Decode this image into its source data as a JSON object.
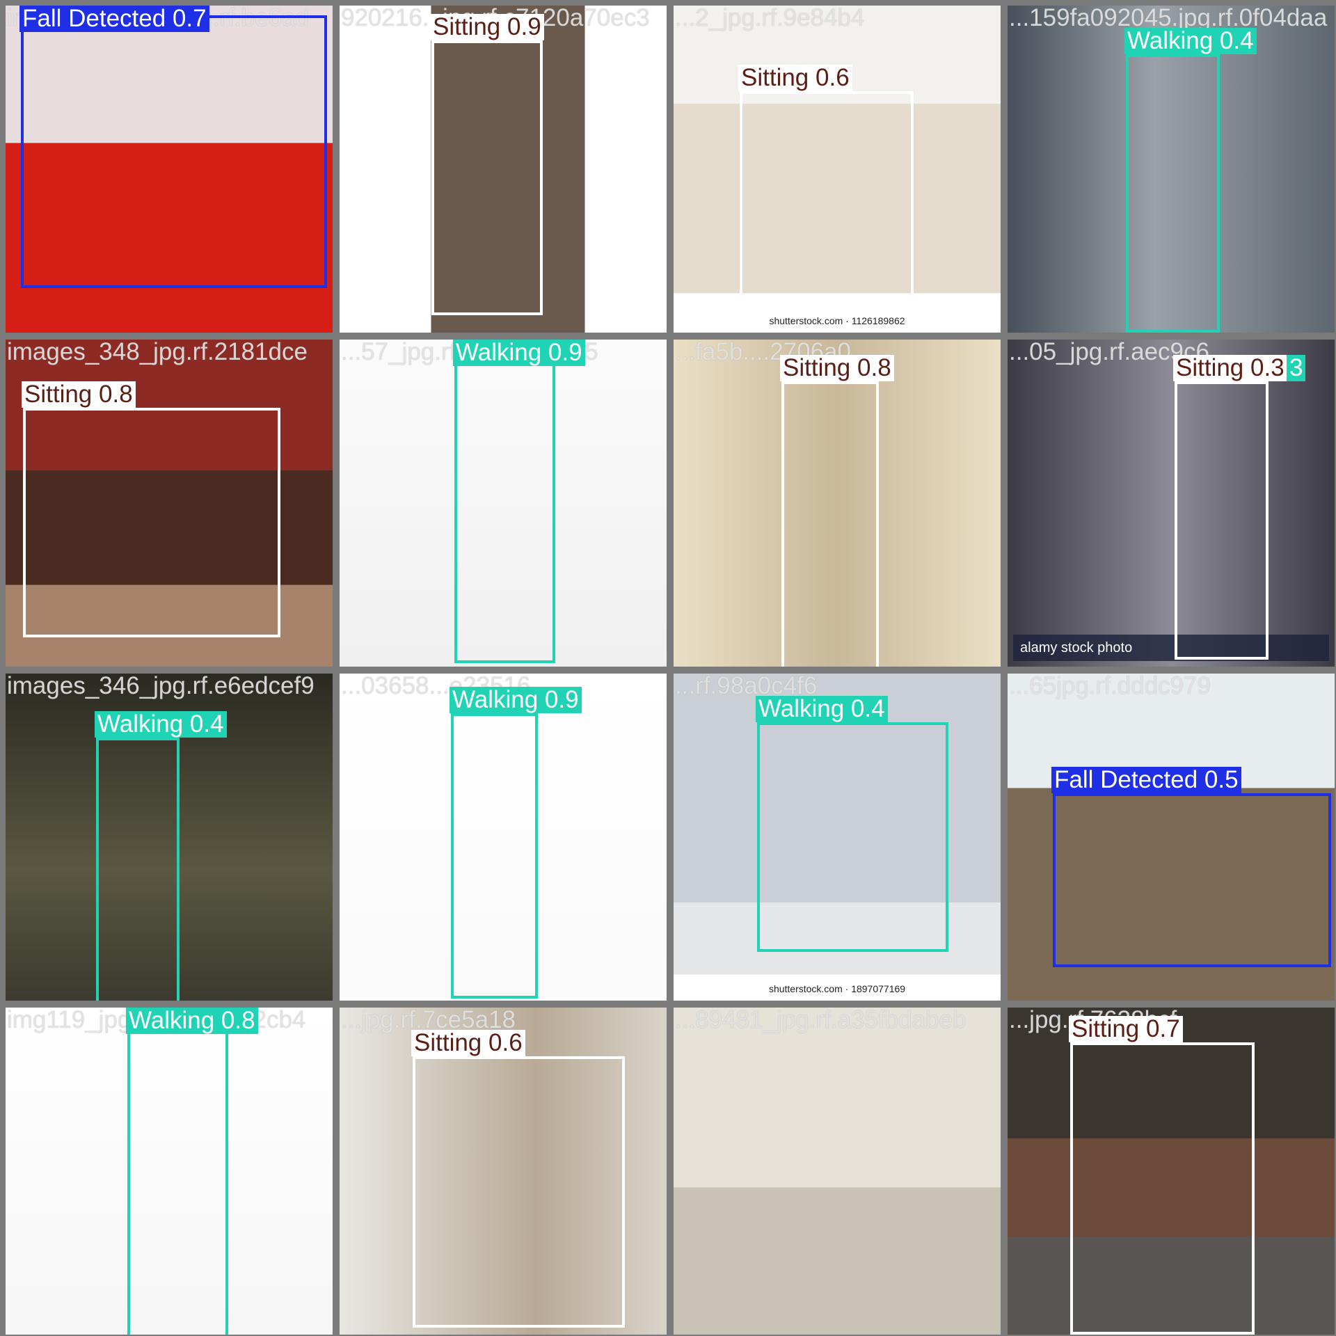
{
  "colors": {
    "walking": "#1fd3b4",
    "sitting": "#ffffff",
    "fall": "#1f2fe6",
    "walking_text": "#ffffff",
    "sitting_text": "#5a1e14",
    "fall_text": "#ffffff"
  },
  "tiles": [
    {
      "filename": "images_303_2_jpg.rf.be6ad",
      "scene": "yoga-red-sofa",
      "detections": [
        {
          "cls": "fall",
          "label": "Fall Detected 0.7"
        }
      ]
    },
    {
      "filename": "920216...jpg.rf.c7120a70ec3",
      "scene": "shop-woman",
      "detections": [
        {
          "cls": "sitting",
          "label": "Sitting 0.9"
        }
      ]
    },
    {
      "filename": "...2_jpg.rf.9e84b4",
      "scene": "sofa-woman",
      "watermark": "shutterstock.com · 1126189862",
      "detections": [
        {
          "cls": "sitting",
          "label": "Sitting 0.6"
        }
      ]
    },
    {
      "filename": "...159fa092045.jpg.rf.0f04daa",
      "scene": "street-woman",
      "detections": [
        {
          "cls": "walking",
          "label": "Walking 0.4"
        }
      ]
    },
    {
      "filename": "images_348_jpg.rf.2181dce",
      "scene": "restaurant-woman",
      "detections": [
        {
          "cls": "sitting",
          "label": "Sitting 0.8"
        }
      ]
    },
    {
      "filename": "...57_jpg.rf.2e3b54b795",
      "scene": "boy-white",
      "detections": [
        {
          "cls": "walking",
          "label": "Walking 0.9"
        }
      ]
    },
    {
      "filename": "...fa5b....2706a0",
      "scene": "kitchen-woman",
      "detections": [
        {
          "cls": "sitting",
          "label": "Sitting 0.8"
        }
      ]
    },
    {
      "filename": "...05_jpg.rf.aec9c6",
      "scene": "library-man",
      "watermark": "alamy stock photo",
      "detections": [
        {
          "cls": "sitting",
          "label": "Sitting 0.3"
        },
        {
          "cls": "walking",
          "label": "3"
        }
      ]
    },
    {
      "filename": "images_346_jpg.rf.e6edcef9",
      "scene": "park-bench",
      "detections": [
        {
          "cls": "walking",
          "label": "Walking 0.4"
        }
      ]
    },
    {
      "filename": "...03658...e23516",
      "scene": "man-walking-white",
      "detections": [
        {
          "cls": "walking",
          "label": "Walking 0.9"
        }
      ]
    },
    {
      "filename": "...rf.98a0c4f6",
      "scene": "man-floor",
      "watermark": "shutterstock.com · 1897077169",
      "detections": [
        {
          "cls": "walking",
          "label": "Walking 0.4"
        }
      ]
    },
    {
      "filename": "...65jpg.rf.dddc979",
      "scene": "airport-lounge",
      "detections": [
        {
          "cls": "fall",
          "label": "Fall Detected 0.5"
        }
      ]
    },
    {
      "filename": "img119_jpg.rf.c50b4762cb4",
      "scene": "girl-white",
      "detections": [
        {
          "cls": "walking",
          "label": "Walking 0.8"
        }
      ]
    },
    {
      "filename": "...jpg.rf.7ce5a18",
      "scene": "old-man-chair",
      "detections": [
        {
          "cls": "sitting",
          "label": "Sitting 0.6"
        }
      ]
    },
    {
      "filename": "...89481_jpg.rf.a35fbdabeb",
      "scene": "old-man-cane",
      "detections": []
    },
    {
      "filename": "...jpg.rf.7638bcf",
      "scene": "man-bench-dark",
      "detections": [
        {
          "cls": "sitting",
          "label": "Sitting 0.7"
        }
      ]
    }
  ]
}
